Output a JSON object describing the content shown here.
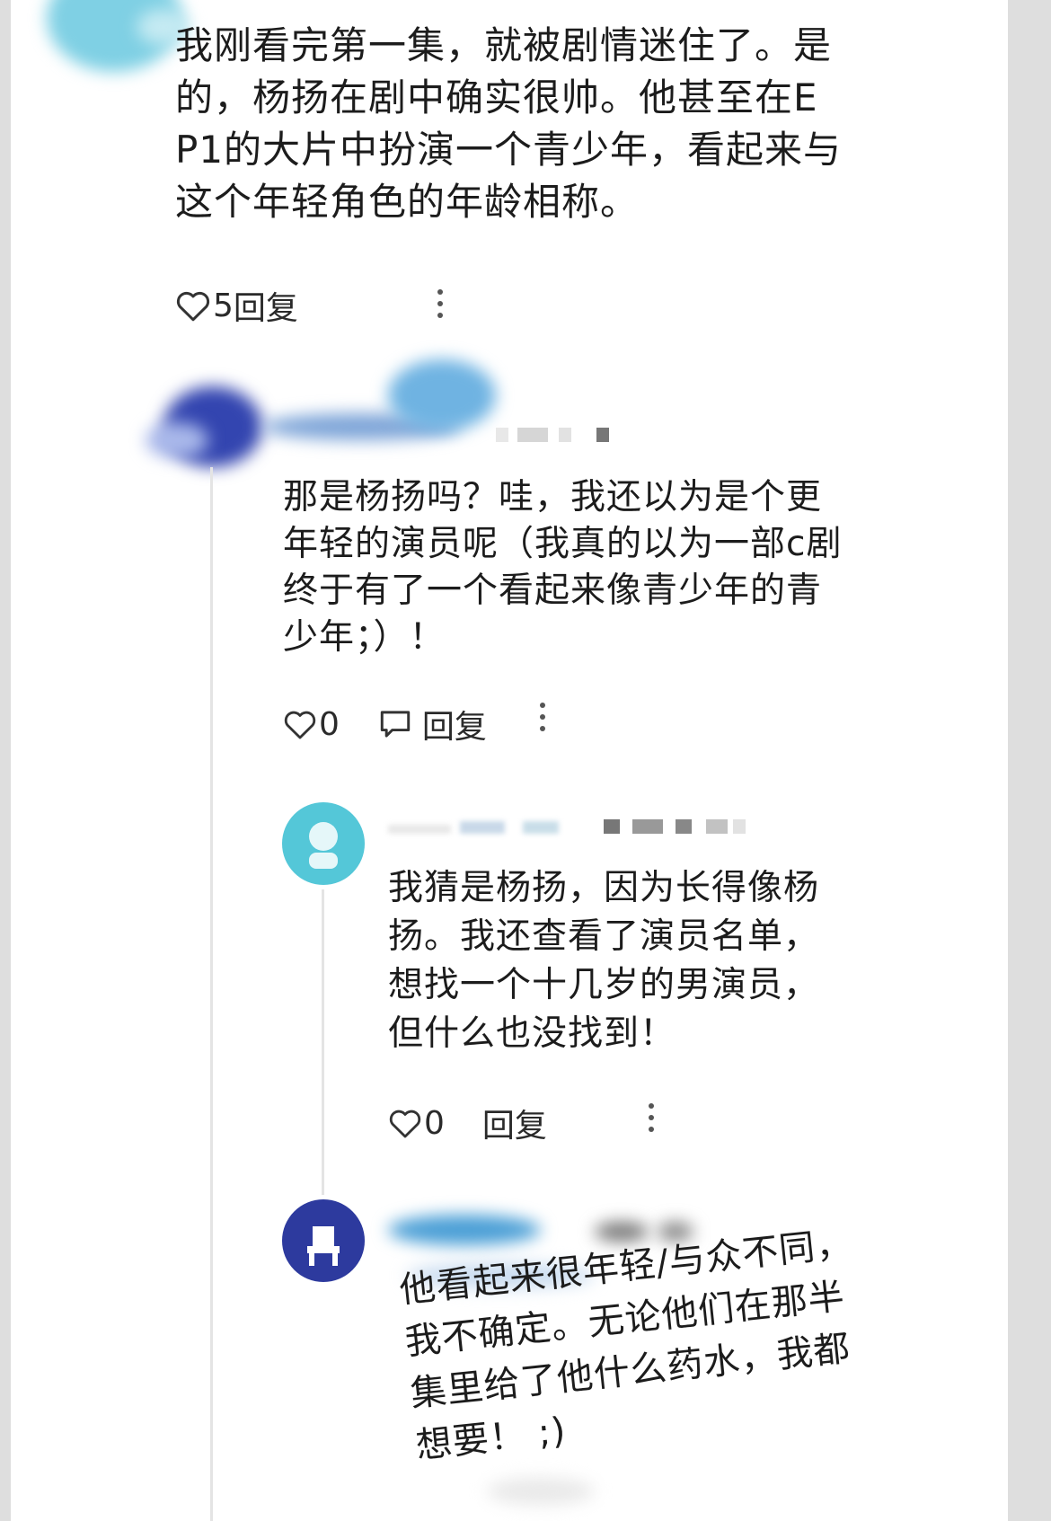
{
  "comments": [
    {
      "body": "我刚看完第一集，就被剧情迷住了。是\n的，杨扬在剧中确实很帅。他甚至在E\nP1的大片中扮演一个青少年，看起来与\n这个年轻角色的年龄相称。",
      "like_count": "5",
      "reply_label": "回复"
    },
    {
      "body": "那是杨扬吗？哇，我还以为是个更\n年轻的演员呢（我真的以为一部c剧\n终于有了一个看起来像青少年的青\n少年；）！",
      "like_count": "0",
      "reply_label": "回复"
    },
    {
      "body": "我猜是杨扬，因为长得像杨\n扬。我还查看了演员名单，\n想找一个十几岁的男演员，\n但什么也没找到！",
      "like_count": "0",
      "reply_label": "回复"
    },
    {
      "body": "他看起来很年轻/与众不同，\n我不确定。无论他们在那半\n集里给了他什么药水，我都\n想要！ ;)"
    }
  ],
  "icons": {
    "heart": "heart-icon",
    "reply": "reply-bubble-icon",
    "more": "more-vertical-icon"
  },
  "colors": {
    "avatar_cyan": "#54c7d8",
    "avatar_navy": "#2d3a9e",
    "avatar_blue": "#3551b8"
  }
}
